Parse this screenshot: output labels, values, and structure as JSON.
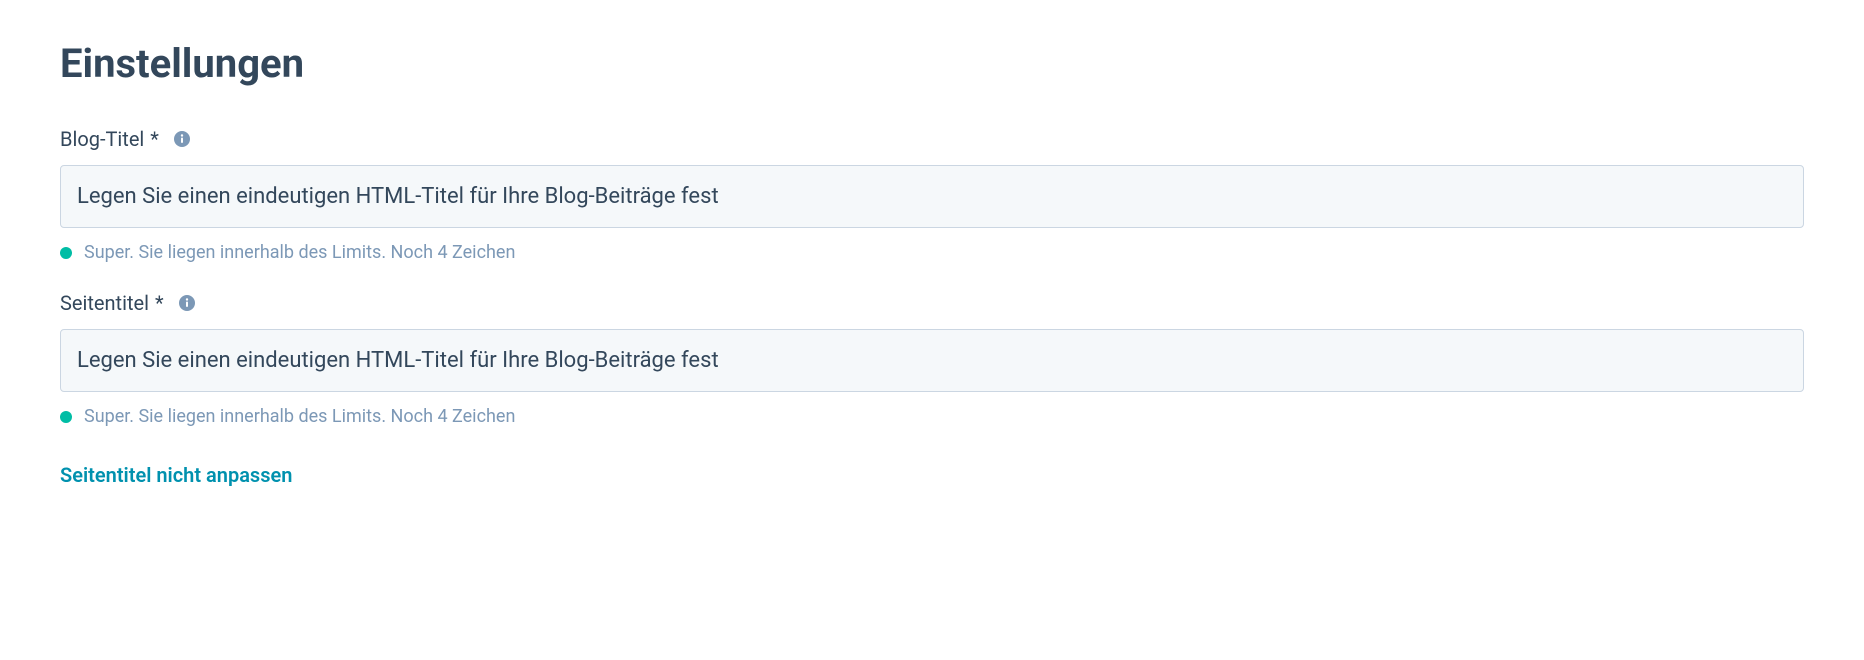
{
  "page": {
    "title": "Einstellungen"
  },
  "fields": {
    "blogTitle": {
      "label": "Blog-Titel",
      "required": "*",
      "value": "Legen Sie einen eindeutigen HTML-Titel für Ihre Blog-Beiträge fest",
      "status": {
        "text": "Super. Sie liegen innerhalb des Limits. Noch 4 Zeichen",
        "color": "#00bda5"
      }
    },
    "pageTitle": {
      "label": "Seitentitel",
      "required": "*",
      "value": "Legen Sie einen eindeutigen HTML-Titel für Ihre Blog-Beiträge fest",
      "status": {
        "text": "Super. Sie liegen innerhalb des Limits. Noch 4 Zeichen",
        "color": "#00bda5"
      }
    }
  },
  "actions": {
    "dontAdjustPageTitle": "Seitentitel nicht anpassen"
  }
}
